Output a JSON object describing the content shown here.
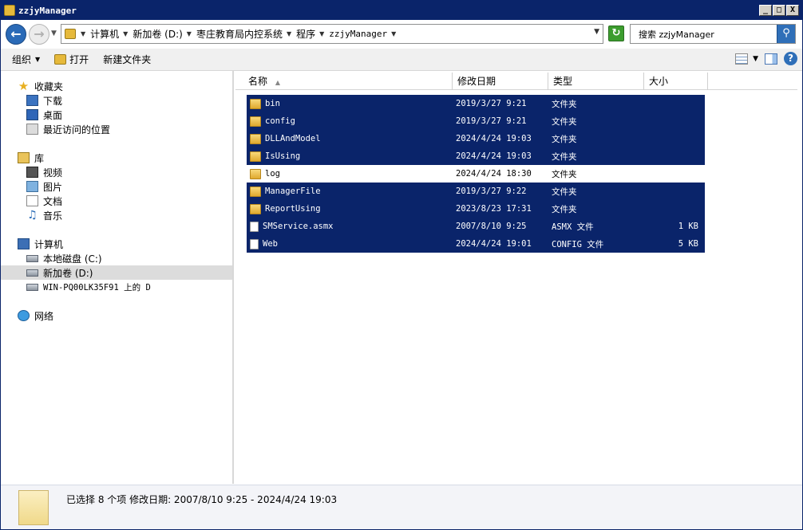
{
  "window": {
    "title": "zzjyManager",
    "btn_min": "_",
    "btn_max": "□",
    "btn_close": "X"
  },
  "address": {
    "crumbs": [
      "计算机",
      "新加卷 (D:)",
      "枣庄教育局内控系统",
      "程序",
      "zzjyManager"
    ],
    "search_placeholder": "搜索 zzjyManager"
  },
  "toolbar": {
    "organize": "组织",
    "open": "打开",
    "new_folder": "新建文件夹",
    "help": "?"
  },
  "sidebar": {
    "favorites": {
      "label": "收藏夹",
      "items": [
        "下载",
        "桌面",
        "最近访问的位置"
      ]
    },
    "libraries": {
      "label": "库",
      "items": [
        "视频",
        "图片",
        "文档",
        "音乐"
      ]
    },
    "computer": {
      "label": "计算机",
      "items": [
        "本地磁盘 (C:)",
        "新加卷 (D:)",
        "WIN-PQ00LK35F91 上的 D"
      ]
    },
    "network": {
      "label": "网络"
    }
  },
  "columns": {
    "name": "名称",
    "modified": "修改日期",
    "type": "类型",
    "size": "大小"
  },
  "files": [
    {
      "name": "bin",
      "date": "2019/3/27 9:21",
      "type": "文件夹",
      "size": "",
      "selected": true,
      "kind": "folder"
    },
    {
      "name": "config",
      "date": "2019/3/27 9:21",
      "type": "文件夹",
      "size": "",
      "selected": true,
      "kind": "folder"
    },
    {
      "name": "DLLAndModel",
      "date": "2024/4/24 19:03",
      "type": "文件夹",
      "size": "",
      "selected": true,
      "kind": "folder"
    },
    {
      "name": "IsUsing",
      "date": "2024/4/24 19:03",
      "type": "文件夹",
      "size": "",
      "selected": true,
      "kind": "folder"
    },
    {
      "name": "log",
      "date": "2024/4/24 18:30",
      "type": "文件夹",
      "size": "",
      "selected": false,
      "kind": "folder"
    },
    {
      "name": "ManagerFile",
      "date": "2019/3/27 9:22",
      "type": "文件夹",
      "size": "",
      "selected": true,
      "kind": "folder"
    },
    {
      "name": "ReportUsing",
      "date": "2023/8/23 17:31",
      "type": "文件夹",
      "size": "",
      "selected": true,
      "kind": "folder"
    },
    {
      "name": "SMService.asmx",
      "date": "2007/8/10 9:25",
      "type": "ASMX 文件",
      "size": "1 KB",
      "selected": true,
      "kind": "file"
    },
    {
      "name": "Web",
      "date": "2024/4/24 19:01",
      "type": "CONFIG 文件",
      "size": "5 KB",
      "selected": true,
      "kind": "file"
    }
  ],
  "status": {
    "text": "已选择 8 个项 修改日期: 2007/8/10 9:25 - 2024/4/24 19:03"
  },
  "colors": {
    "selection": "#0a246a",
    "titlebar": "#0a246a"
  }
}
